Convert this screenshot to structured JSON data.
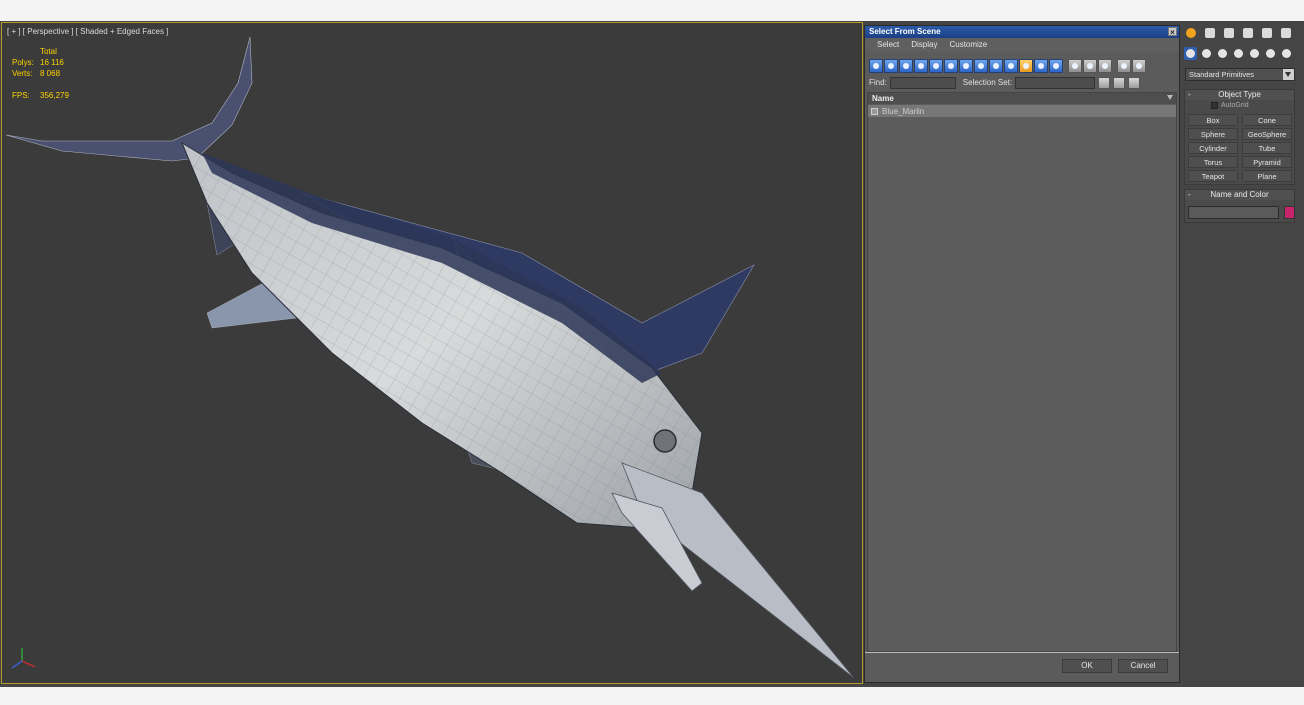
{
  "viewport": {
    "label": "[ + ] [ Perspective ] [ Shaded + Edged Faces ]",
    "stats": {
      "total_label": "Total",
      "polys_label": "Polys:",
      "polys_value": "16 116",
      "verts_label": "Verts:",
      "verts_value": "8 068",
      "fps_label": "FPS:",
      "fps_value": "356,279"
    },
    "model": "marlin-mesh",
    "gizmo": "axis-gizmo-icon"
  },
  "dialog": {
    "title": "Select From Scene",
    "menu": [
      "Select",
      "Display",
      "Customize"
    ],
    "find_label": "Find:",
    "find_value": "",
    "selection_set_label": "Selection Set:",
    "selection_set_value": "",
    "list_header": "Name",
    "items": [
      {
        "name": "Blue_Marlin",
        "selected": true
      }
    ],
    "ok_label": "OK",
    "cancel_label": "Cancel"
  },
  "command_panel": {
    "tabs": [
      "create-icon",
      "modify-icon",
      "hierarchy-icon",
      "motion-icon",
      "display-icon",
      "utilities-icon"
    ],
    "subtabs": [
      "geometry-icon",
      "shapes-icon",
      "lights-icon",
      "cameras-icon",
      "helpers-icon",
      "spacewarps-icon",
      "systems-icon"
    ],
    "dropdown_value": "Standard Primitives",
    "object_type_title": "Object Type",
    "autogrid_label": "AutoGrid",
    "primitives": [
      "Box",
      "Cone",
      "Sphere",
      "GeoSphere",
      "Cylinder",
      "Tube",
      "Torus",
      "Pyramid",
      "Teapot",
      "Plane"
    ],
    "name_color_title": "Name and Color",
    "object_name": "",
    "object_color": "#c7256b"
  },
  "colors": {
    "viewport_bg": "#3b3b3b",
    "stats_text": "#ffd200",
    "title_bar": "#1b3f85",
    "accent": "#f2a31d"
  }
}
